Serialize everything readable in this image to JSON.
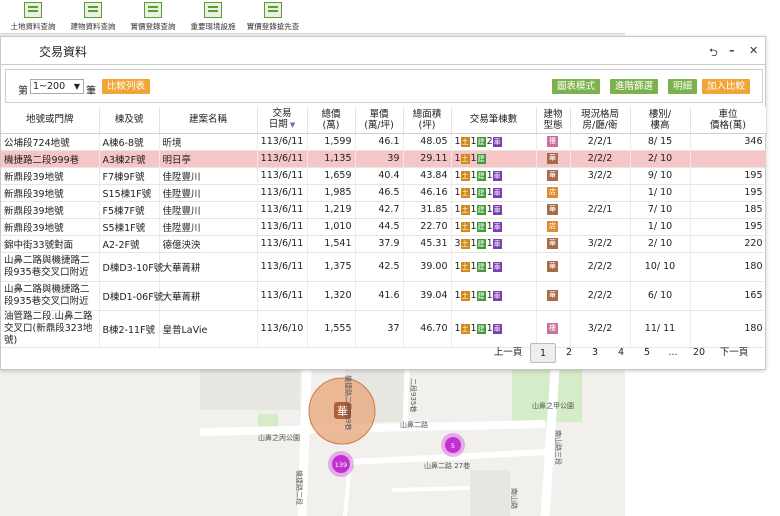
{
  "toolbar": [
    {
      "label": "土地資料查詢",
      "icon": "land-data-icon"
    },
    {
      "label": "建物資料查詢",
      "icon": "building-data-icon"
    },
    {
      "label": "實價登錄查詢",
      "icon": "price-registry-icon"
    },
    {
      "label": "重要環境設施",
      "icon": "environment-facility-icon"
    },
    {
      "label": "實價登錄搶先查",
      "icon": "price-preview-icon"
    }
  ],
  "dialog": {
    "title": "交易資料",
    "page_prefix": "第",
    "page_range": "1~200",
    "page_unit": "筆",
    "compare_list": "比較列表",
    "buttons": [
      "圖表模式",
      "進階篩選",
      "明細",
      "加入比較"
    ]
  },
  "table": {
    "headers": [
      "地號或門牌",
      "棟及號",
      "建案名稱",
      "交易\n日期",
      "總價\n(萬)",
      "單價\n(萬/坪)",
      "總面積\n(坪)",
      "交易筆棟數",
      "建物\n型態",
      "現況格局\n房/廳/衛",
      "樓別/\n樓高",
      "車位\n價格(萬)"
    ],
    "tag_labels": {
      "land": "土",
      "building": "建",
      "car": "車"
    },
    "rows": [
      {
        "addr": "公埔段724地號",
        "unit": "A棟6-8號",
        "project": "昕境",
        "date": "113/6/11",
        "total": "1,599",
        "unit_price": "46.1",
        "area": "48.05",
        "counts": [
          1,
          1,
          2
        ],
        "type": "樓",
        "type_class": "b-a",
        "layout": "2/2/1",
        "floor": "8/ 15",
        "parking": "346",
        "highlight": false
      },
      {
        "addr": "機捷路二段999巷",
        "unit": "A3棟2F號",
        "project": "明日亭",
        "date": "113/6/11",
        "total": "1,135",
        "unit_price": "39",
        "area": "29.11",
        "counts": [
          1,
          1,
          0
        ],
        "type": "華",
        "type_class": "b-b",
        "layout": "2/2/2",
        "floor": "2/ 10",
        "parking": "",
        "highlight": true
      },
      {
        "addr": "新鼎段39地號",
        "unit": "F7棟9F號",
        "project": "佳陞豐川",
        "date": "113/6/11",
        "total": "1,659",
        "unit_price": "40.4",
        "area": "43.84",
        "counts": [
          1,
          1,
          1
        ],
        "type": "華",
        "type_class": "b-b",
        "layout": "3/2/2",
        "floor": "9/ 10",
        "parking": "195",
        "highlight": false
      },
      {
        "addr": "新鼎段39地號",
        "unit": "S15棟1F號",
        "project": "佳陞豐川",
        "date": "113/6/11",
        "total": "1,985",
        "unit_price": "46.5",
        "area": "46.16",
        "counts": [
          1,
          1,
          1
        ],
        "type": "店",
        "type_class": "b-c",
        "layout": "",
        "floor": "1/ 10",
        "parking": "195",
        "highlight": false
      },
      {
        "addr": "新鼎段39地號",
        "unit": "F5棟7F號",
        "project": "佳陞豐川",
        "date": "113/6/11",
        "total": "1,219",
        "unit_price": "42.7",
        "area": "31.85",
        "counts": [
          1,
          1,
          1
        ],
        "type": "華",
        "type_class": "b-b",
        "layout": "2/2/1",
        "floor": "7/ 10",
        "parking": "185",
        "highlight": false
      },
      {
        "addr": "新鼎段39地號",
        "unit": "S5棟1F號",
        "project": "佳陞豐川",
        "date": "113/6/11",
        "total": "1,010",
        "unit_price": "44.5",
        "area": "22.70",
        "counts": [
          1,
          1,
          1
        ],
        "type": "店",
        "type_class": "b-c",
        "layout": "",
        "floor": "1/ 10",
        "parking": "195",
        "highlight": false
      },
      {
        "addr": "錦中街33號對面",
        "unit": "A2-2F號",
        "project": "德億泱泱",
        "date": "113/6/11",
        "total": "1,541",
        "unit_price": "37.9",
        "area": "45.31",
        "counts": [
          3,
          1,
          1
        ],
        "type": "華",
        "type_class": "b-b",
        "layout": "3/2/2",
        "floor": "2/ 10",
        "parking": "220",
        "highlight": false
      },
      {
        "addr": "山鼻二路與機捷路二段935巷交叉口附近",
        "unit": "D棟D3-10F號",
        "project": "大華菁耕",
        "date": "113/6/11",
        "total": "1,375",
        "unit_price": "42.5",
        "area": "39.00",
        "counts": [
          1,
          1,
          1
        ],
        "type": "華",
        "type_class": "b-b",
        "layout": "2/2/2",
        "floor": "10/ 10",
        "parking": "180",
        "highlight": false,
        "tall": true
      },
      {
        "addr": "山鼻二路與機捷路二段935巷交叉口附近",
        "unit": "D棟D1-06F號",
        "project": "大華菁耕",
        "date": "113/6/11",
        "total": "1,320",
        "unit_price": "41.6",
        "area": "39.04",
        "counts": [
          1,
          1,
          1
        ],
        "type": "華",
        "type_class": "b-b",
        "layout": "2/2/2",
        "floor": "6/ 10",
        "parking": "165",
        "highlight": false,
        "tall": true
      },
      {
        "addr": "油管路二段.山鼻二路交叉口(新鼎段323地號)",
        "unit": "B棟2-11F號",
        "project": "皇普LaVie",
        "date": "113/6/10",
        "total": "1,555",
        "unit_price": "37",
        "area": "46.70",
        "counts": [
          1,
          1,
          1
        ],
        "type": "樓",
        "type_class": "b-a",
        "layout": "3/2/2",
        "floor": "11/ 11",
        "parking": "180",
        "highlight": false,
        "tall": true
      }
    ]
  },
  "pagination": {
    "prev": "上一頁",
    "pages": [
      "1",
      "2",
      "3",
      "4",
      "5",
      "...",
      "20"
    ],
    "next": "下一頁",
    "current": "1"
  },
  "map": {
    "labels": {
      "road_shanbi2": "山鼻二路",
      "road_shanbi2_b": "山鼻二路",
      "road_shanbi2_lane27": "山鼻二路 27巷",
      "park_1": "山鼻之丙公園",
      "park_2": "山鼻之甲公園",
      "road_nanshan3": "南山路三段",
      "road_jijie": "機捷路二段",
      "road_lane935": "二段935巷",
      "road_nanshan": "南山路",
      "road_jijie_b": "機捷路二段999巷"
    },
    "marker_main": "華",
    "cluster_a": "139",
    "cluster_b": "5",
    "colors": {
      "road": "#ffffff",
      "park": "#d5ecc8",
      "marker": "#e8a57a",
      "cluster": "#c42fd3",
      "bg": "#f1f0ec"
    }
  }
}
